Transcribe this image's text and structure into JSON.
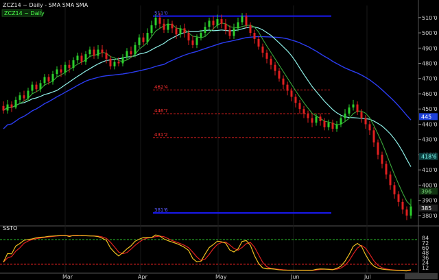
{
  "header": {
    "symbol_line": "ZCZ14 ~ Daily  -  SMA SMA SMA",
    "legend_label": "ZCZ14 ~ Daily"
  },
  "oscillator": {
    "label": "SSTO",
    "ticks": [
      "84",
      "72",
      "60",
      "48",
      "36",
      "24",
      "12"
    ]
  },
  "months": [
    "Mar",
    "Apr",
    "May",
    "Jun",
    "Jul"
  ],
  "price_ticks": [
    "510'0",
    "500'0",
    "490'0",
    "480'0",
    "470'0",
    "460'0",
    "450'0",
    "440'0",
    "430'0",
    "420'0",
    "410'0",
    "400'0",
    "390'0",
    "380'0"
  ],
  "value_tags": [
    {
      "text": "445",
      "y": 445,
      "color": "#1c3fd8",
      "fg": "#ffffff"
    },
    {
      "text": "418'6",
      "y": 418.75,
      "color": "#0b4040",
      "fg": "#7ff5ea"
    },
    {
      "text": "396",
      "y": 396,
      "color": "#113311",
      "fg": "#7cdb7c"
    },
    {
      "text": "385",
      "y": 385,
      "color": "#202020",
      "fg": "#ffffff"
    }
  ],
  "fib_levels": [
    {
      "label": "511'0",
      "value": 511,
      "style": "blue"
    },
    {
      "label": "462'4",
      "value": 462.5,
      "style": "red"
    },
    {
      "label": "446'7",
      "value": 446.875,
      "style": "red"
    },
    {
      "label": "431'2",
      "value": 431.25,
      "style": "red"
    },
    {
      "label": "381'6",
      "value": 381.75,
      "style": "blue"
    }
  ],
  "chart_data": {
    "type": "line",
    "title": "ZCZ14 ~ Daily",
    "ylim": [
      375,
      518
    ],
    "x_categories": [
      "Mar",
      "Apr",
      "May",
      "Jun",
      "Jul"
    ],
    "candles": [
      [
        452,
        449,
        455,
        447
      ],
      [
        449,
        453,
        456,
        447
      ],
      [
        453,
        451,
        455,
        448
      ],
      [
        451,
        456,
        458,
        450
      ],
      [
        456,
        459,
        461,
        454
      ],
      [
        459,
        457,
        462,
        455
      ],
      [
        457,
        462,
        464,
        455
      ],
      [
        462,
        466,
        468,
        460
      ],
      [
        466,
        463,
        468,
        461
      ],
      [
        463,
        467,
        469,
        461
      ],
      [
        467,
        471,
        473,
        465
      ],
      [
        471,
        468,
        473,
        466
      ],
      [
        468,
        473,
        475,
        466
      ],
      [
        473,
        476,
        478,
        471
      ],
      [
        476,
        474,
        479,
        471
      ],
      [
        474,
        479,
        481,
        472
      ],
      [
        479,
        477,
        482,
        474
      ],
      [
        477,
        482,
        484,
        475
      ],
      [
        482,
        485,
        487,
        480
      ],
      [
        485,
        481,
        487,
        479
      ],
      [
        481,
        486,
        488,
        479
      ],
      [
        486,
        489,
        491,
        484
      ],
      [
        489,
        485,
        491,
        483
      ],
      [
        485,
        489,
        492,
        483
      ],
      [
        489,
        487,
        492,
        484
      ],
      [
        487,
        483,
        489,
        480
      ],
      [
        483,
        478,
        485,
        476
      ],
      [
        478,
        481,
        483,
        476
      ],
      [
        481,
        480,
        484,
        478
      ],
      [
        480,
        484,
        486,
        478
      ],
      [
        484,
        488,
        490,
        482
      ],
      [
        488,
        486,
        491,
        484
      ],
      [
        486,
        492,
        494,
        484
      ],
      [
        492,
        497,
        499,
        490
      ],
      [
        497,
        494,
        500,
        492
      ],
      [
        494,
        500,
        503,
        492
      ],
      [
        500,
        505,
        508,
        498
      ],
      [
        505,
        510,
        512,
        503
      ],
      [
        510,
        506,
        513,
        503
      ],
      [
        506,
        502,
        509,
        500
      ],
      [
        502,
        506,
        509,
        500
      ],
      [
        506,
        503,
        508,
        500
      ],
      [
        503,
        499,
        505,
        496
      ],
      [
        499,
        503,
        505,
        497
      ],
      [
        503,
        500,
        506,
        497
      ],
      [
        500,
        495,
        502,
        492
      ],
      [
        495,
        492,
        498,
        490
      ],
      [
        492,
        497,
        499,
        490
      ],
      [
        497,
        500,
        502,
        495
      ],
      [
        500,
        504,
        507,
        498
      ],
      [
        504,
        508,
        510,
        502
      ],
      [
        508,
        505,
        511,
        502
      ],
      [
        505,
        509,
        512,
        503
      ],
      [
        509,
        506,
        512,
        503
      ],
      [
        506,
        502,
        509,
        499
      ],
      [
        502,
        498,
        505,
        496
      ],
      [
        498,
        503,
        506,
        496
      ],
      [
        503,
        507,
        510,
        501
      ],
      [
        507,
        511,
        513,
        505
      ],
      [
        511,
        505,
        513,
        503
      ],
      [
        505,
        500,
        507,
        498
      ],
      [
        500,
        496,
        502,
        493
      ],
      [
        496,
        491,
        498,
        489
      ],
      [
        491,
        487,
        493,
        484
      ],
      [
        487,
        483,
        489,
        480
      ],
      [
        483,
        479,
        485,
        476
      ],
      [
        479,
        475,
        481,
        472
      ],
      [
        475,
        470,
        477,
        468
      ],
      [
        470,
        466,
        472,
        463
      ],
      [
        466,
        462,
        468,
        459
      ],
      [
        462,
        458,
        464,
        455
      ],
      [
        458,
        454,
        460,
        451
      ],
      [
        454,
        450,
        456,
        447
      ],
      [
        450,
        447,
        452,
        444
      ],
      [
        447,
        444,
        449,
        441
      ],
      [
        444,
        441,
        447,
        438
      ],
      [
        441,
        445,
        447,
        439
      ],
      [
        445,
        442,
        447,
        439
      ],
      [
        442,
        438,
        444,
        436
      ],
      [
        438,
        441,
        443,
        436
      ],
      [
        441,
        437,
        443,
        435
      ],
      [
        437,
        440,
        442,
        435
      ],
      [
        440,
        444,
        446,
        438
      ],
      [
        444,
        447,
        450,
        442
      ],
      [
        447,
        451,
        453,
        445
      ],
      [
        451,
        453,
        456,
        449
      ],
      [
        453,
        448,
        455,
        446
      ],
      [
        448,
        444,
        450,
        441
      ],
      [
        444,
        440,
        446,
        437
      ],
      [
        440,
        436,
        442,
        433
      ],
      [
        436,
        428,
        438,
        425
      ],
      [
        428,
        420,
        430,
        417
      ],
      [
        420,
        414,
        422,
        411
      ],
      [
        414,
        407,
        416,
        404
      ],
      [
        407,
        400,
        409,
        397
      ],
      [
        400,
        394,
        402,
        391
      ],
      [
        394,
        389,
        396,
        386
      ],
      [
        389,
        384,
        391,
        381
      ],
      [
        384,
        380,
        386,
        377
      ],
      [
        380,
        386,
        391,
        378
      ]
    ],
    "sma_short": [],
    "sma_mid": [],
    "sma_long": [],
    "ssto": []
  }
}
